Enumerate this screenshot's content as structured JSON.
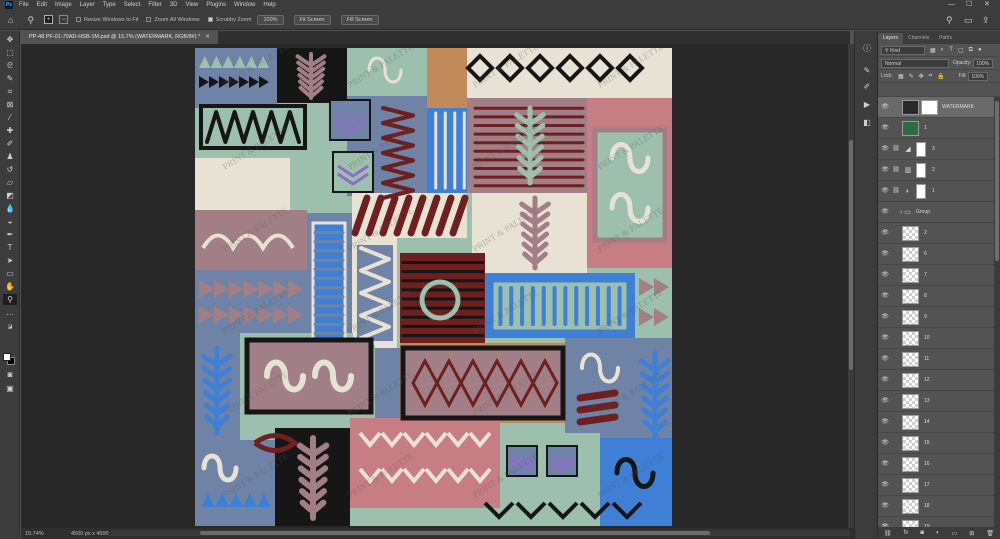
{
  "app": {
    "menu": [
      "File",
      "Edit",
      "Image",
      "Layer",
      "Type",
      "Select",
      "Filter",
      "3D",
      "View",
      "Plugins",
      "Window",
      "Help"
    ],
    "window_controls": {
      "min": "—",
      "max": "☐",
      "close": "✕"
    }
  },
  "options": {
    "resize_windows_label": "Resize Windows to Fit",
    "zoom_all_label": "Zoom All Windows",
    "scrubby_label": "Scrubby Zoom",
    "zoom_100": "100%",
    "fit_screen": "Fit Screen",
    "fill_screen": "Fill Screen"
  },
  "document": {
    "tab_title": "PP-48 PF-01-70AD-HSB-1M.psd @ 15.7% (WATERMARK, RGB/8#) *",
    "tab_close": "✕",
    "status_zoom": "15.74%",
    "status_info": "4500 px x 4500 px (300 ppi)",
    "status_arrow": "›"
  },
  "watermark": "PRINT & PALETTE",
  "layers_panel": {
    "tabs": [
      "Layers",
      "Channels",
      "Paths"
    ],
    "kind": "Kind",
    "blend_mode": "Normal",
    "opacity_label": "Opacity:",
    "opacity_value": "100%",
    "lock_label": "Lock:",
    "fill_label": "Fill:",
    "fill_value": "100%",
    "layers": [
      {
        "name": "WATERMARK",
        "type": "watermark",
        "selected": true
      },
      {
        "name": "1",
        "type": "art"
      },
      {
        "name": "3",
        "type": "adjust",
        "icon": "◢"
      },
      {
        "name": "2",
        "type": "adjust",
        "icon": "▥"
      },
      {
        "name": "1",
        "type": "adjust",
        "icon": "◐"
      },
      {
        "name": "Group",
        "type": "group"
      },
      {
        "name": "2",
        "type": "pixel"
      },
      {
        "name": "6",
        "type": "pixel"
      },
      {
        "name": "7",
        "type": "pixel"
      },
      {
        "name": "8",
        "type": "pixel"
      },
      {
        "name": "9",
        "type": "pixel"
      },
      {
        "name": "10",
        "type": "pixel"
      },
      {
        "name": "11",
        "type": "pixel"
      },
      {
        "name": "12",
        "type": "pixel"
      },
      {
        "name": "13",
        "type": "pixel"
      },
      {
        "name": "14",
        "type": "pixel"
      },
      {
        "name": "15",
        "type": "pixel"
      },
      {
        "name": "16",
        "type": "pixel"
      },
      {
        "name": "17",
        "type": "pixel"
      },
      {
        "name": "18",
        "type": "pixel"
      },
      {
        "name": "19",
        "type": "pixel"
      },
      {
        "name": "20",
        "type": "pixel"
      }
    ],
    "footer_icons": [
      "link-icon",
      "fx-icon",
      "mask-icon",
      "adjustment-icon",
      "folder-icon",
      "new-layer-icon",
      "trash-icon"
    ]
  },
  "colors": {
    "slate": "#6f83a6",
    "sage": "#9cbfae",
    "rose": "#c67d84",
    "maroon": "#6e1f1f",
    "cream": "#e8e2d4",
    "blue": "#3f7fd6",
    "tan": "#c28a5a",
    "black": "#161616",
    "mauve": "#a27f86",
    "violet": "#8d6fc7"
  }
}
